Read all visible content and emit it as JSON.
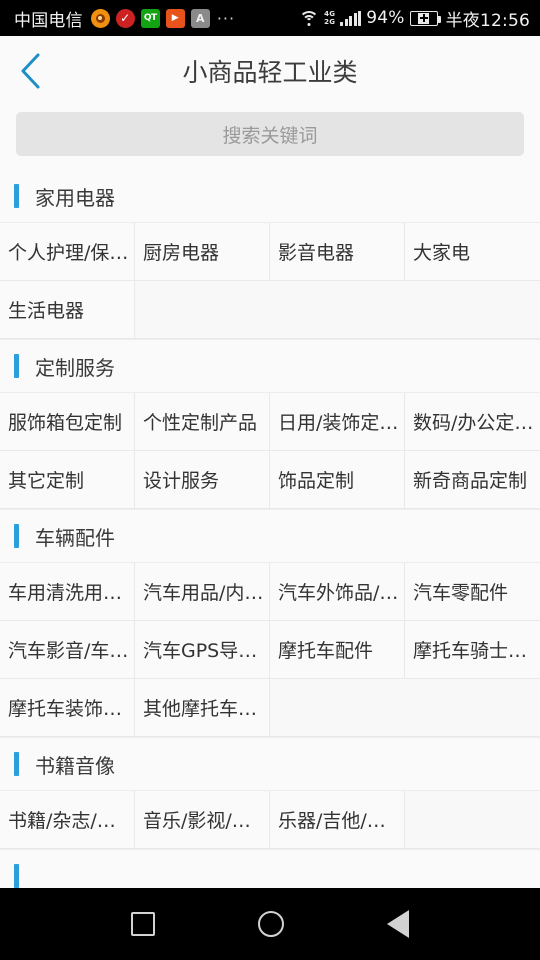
{
  "status_bar": {
    "carrier": "中国电信",
    "icons": [
      "weibo-icon",
      "check-circle-icon",
      "qt-app-icon",
      "play-app-icon",
      "letter-a-app-icon",
      "more-icons-ellipsis"
    ],
    "ellipsis": "···",
    "wifi": "wifi-icon",
    "network_top": "4G",
    "network_bottom": "2G",
    "battery_percent": "94%",
    "battery": "battery-charging-icon",
    "time": "半夜12:56"
  },
  "appbar": {
    "back": "‹",
    "title": "小商品轻工业类"
  },
  "search": {
    "placeholder": "搜索关键词",
    "value": ""
  },
  "colors": {
    "accent": "#2b9fdb",
    "page_bg": "#fafafa",
    "grid_bg": "#f6f6f6",
    "cell_border": "#e9e9e9",
    "title_text": "#3c3c3c"
  },
  "sections": [
    {
      "title": "家用电器",
      "items": [
        "个人护理/保…",
        "厨房电器",
        "影音电器",
        "大家电",
        "生活电器"
      ]
    },
    {
      "title": "定制服务",
      "items": [
        "服饰箱包定制",
        "个性定制产品",
        "日用/装饰定…",
        "数码/办公定…",
        "其它定制",
        "设计服务",
        "饰品定制",
        "新奇商品定制"
      ]
    },
    {
      "title": "车辆配件",
      "items": [
        "车用清洗用…",
        "汽车用品/内…",
        "汽车外饰品/…",
        "汽车零配件",
        "汽车影音/车…",
        "汽车GPS导…",
        "摩托车配件",
        "摩托车骑士…",
        "摩托车装饰…",
        "其他摩托车…"
      ]
    },
    {
      "title": "书籍音像",
      "items": [
        "书籍/杂志/…",
        "音乐/影视/…",
        "乐器/吉他/…"
      ]
    },
    {
      "title": "",
      "items": []
    }
  ],
  "navbar": {
    "recents": "recents-square-icon",
    "home": "home-circle-icon",
    "back": "back-triangle-icon"
  }
}
